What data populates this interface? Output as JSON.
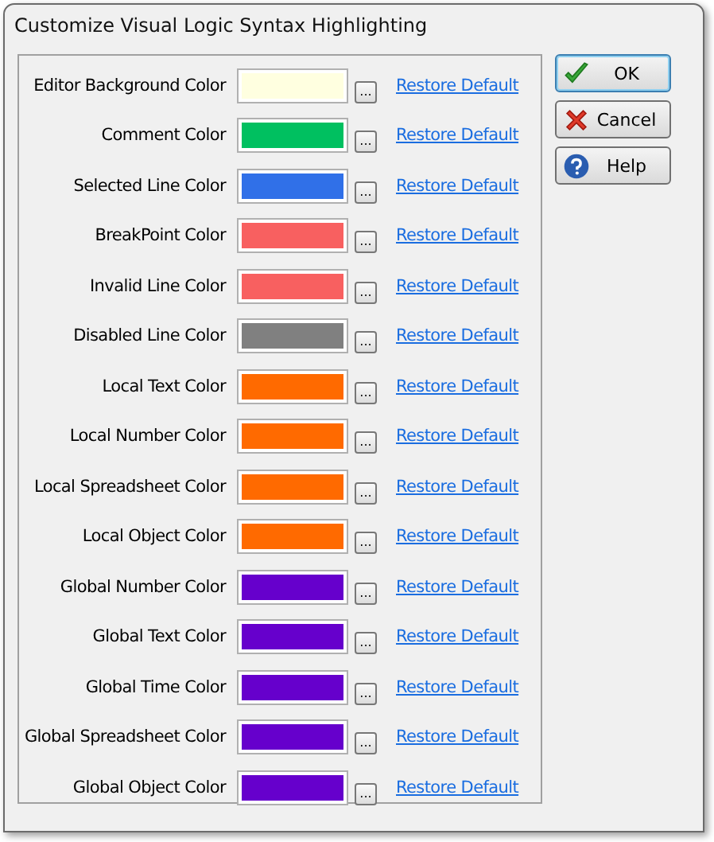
{
  "window": {
    "title": "Customize Visual Logic Syntax Highlighting"
  },
  "settings": [
    {
      "label": "Editor Background Color",
      "color": "#ffffe0",
      "browse": "...",
      "restore": "Restore Default"
    },
    {
      "label": "Comment Color",
      "color": "#00c060",
      "browse": "...",
      "restore": "Restore Default"
    },
    {
      "label": "Selected Line Color",
      "color": "#3070e8",
      "browse": "...",
      "restore": "Restore Default"
    },
    {
      "label": "BreakPoint Color",
      "color": "#f86060",
      "browse": "...",
      "restore": "Restore Default"
    },
    {
      "label": "Invalid Line Color",
      "color": "#f86060",
      "browse": "...",
      "restore": "Restore Default"
    },
    {
      "label": "Disabled Line Color",
      "color": "#808080",
      "browse": "...",
      "restore": "Restore Default"
    },
    {
      "label": "Local Text Color",
      "color": "#ff6a00",
      "browse": "...",
      "restore": "Restore Default"
    },
    {
      "label": "Local Number Color",
      "color": "#ff6a00",
      "browse": "...",
      "restore": "Restore Default"
    },
    {
      "label": "Local Spreadsheet Color",
      "color": "#ff6a00",
      "browse": "...",
      "restore": "Restore Default"
    },
    {
      "label": "Local Object Color",
      "color": "#ff6a00",
      "browse": "...",
      "restore": "Restore Default"
    },
    {
      "label": "Global Number Color",
      "color": "#6600cc",
      "browse": "...",
      "restore": "Restore Default"
    },
    {
      "label": "Global Text Color",
      "color": "#6600cc",
      "browse": "...",
      "restore": "Restore Default"
    },
    {
      "label": "Global Time Color",
      "color": "#6600cc",
      "browse": "...",
      "restore": "Restore Default"
    },
    {
      "label": "Global Spreadsheet Color",
      "color": "#6600cc",
      "browse": "...",
      "restore": "Restore Default"
    },
    {
      "label": "Global Object Color",
      "color": "#6600cc",
      "browse": "...",
      "restore": "Restore Default"
    }
  ],
  "buttons": [
    {
      "label": "OK",
      "kind": "ok",
      "focused": true
    },
    {
      "label": "Cancel",
      "kind": "cancel",
      "focused": false
    },
    {
      "label": "Help",
      "kind": "help",
      "focused": false
    }
  ]
}
